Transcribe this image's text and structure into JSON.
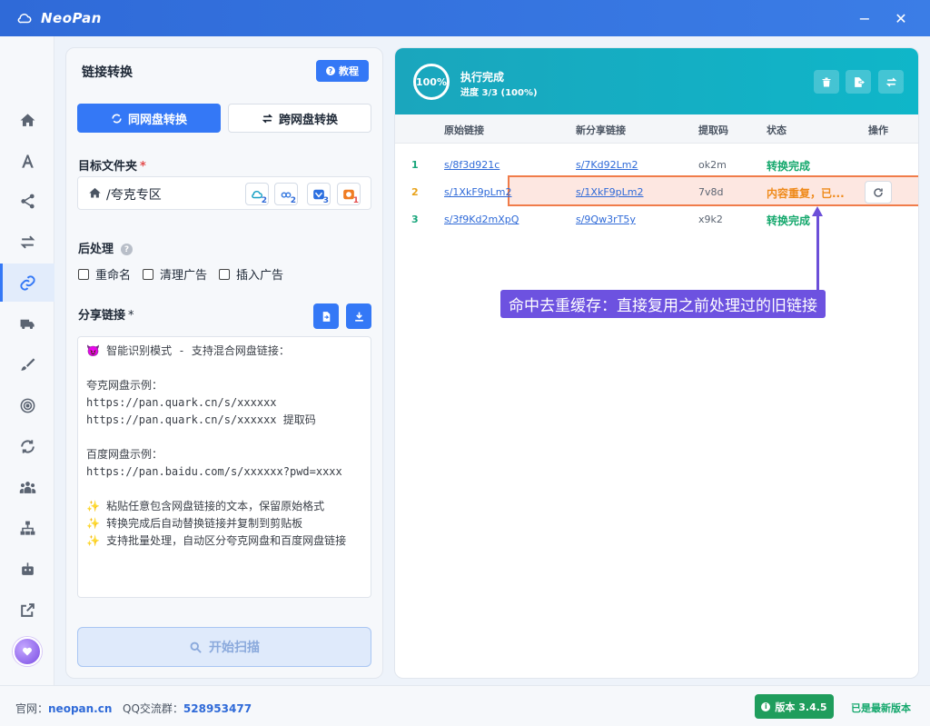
{
  "app": {
    "title": "NeoPan",
    "minimize": "−",
    "close": "✕"
  },
  "sidebar": {
    "items": [
      {
        "name": "home-icon"
      },
      {
        "name": "font-a-icon"
      },
      {
        "name": "share-icon"
      },
      {
        "name": "transfer-icon"
      },
      {
        "name": "link-icon",
        "active": true
      },
      {
        "name": "truck-icon"
      },
      {
        "name": "brush-icon"
      },
      {
        "name": "target-icon"
      },
      {
        "name": "sync-icon"
      },
      {
        "name": "users-icon"
      },
      {
        "name": "sitemap-icon"
      },
      {
        "name": "robot-icon"
      },
      {
        "name": "external-link-icon"
      }
    ]
  },
  "left": {
    "title": "链接转换",
    "tutorial": "教程",
    "mode_same": "同网盘转换",
    "mode_cross": "跨网盘转换",
    "target_folder_label": "目标文件夹",
    "required_mark": "*",
    "folder_name": "/夸克专区",
    "drive_subs": [
      "2",
      "2",
      "3",
      "1"
    ],
    "post_label": "后处理",
    "post_help": "?",
    "options": [
      "重命名",
      "清理广告",
      "插入广告"
    ],
    "share_label": "分享链接",
    "share_required": "*",
    "placeholder": "😈 智能识别模式 - 支持混合网盘链接：\n\n夸克网盘示例：\nhttps://pan.quark.cn/s/xxxxxx\nhttps://pan.quark.cn/s/xxxxxx 提取码\n\n百度网盘示例：\nhttps://pan.baidu.com/s/xxxxxx?pwd=xxxx\n\n✨ 粘贴任意包含网盘链接的文本，保留原始格式\n✨ 转换完成后自动替换链接并复制到剪贴板\n✨ 支持批量处理，自动区分夸克网盘和百度网盘链接",
    "scan": "开始扫描"
  },
  "right": {
    "progress": "100%",
    "progress_value": 100,
    "status": "执行完成",
    "status_sub": "进度 3/3 (100%)",
    "columns": [
      "原始链接",
      "新分享链接",
      "提取码",
      "状态",
      "操作"
    ],
    "rows": [
      {
        "idx": "1",
        "orig": "s/8f3d921c",
        "new": "s/7Kd92Lm2",
        "code": "ok2m",
        "status": "转换完成",
        "state": "ok"
      },
      {
        "idx": "2",
        "orig": "s/1XkF9pLm2",
        "new": "s/1XkF9pLm2",
        "code": "7v8d",
        "status": "内容重复，已...",
        "state": "dup"
      },
      {
        "idx": "3",
        "orig": "s/3f9Kd2mXpQ",
        "new": "s/9Qw3rT5y",
        "code": "x9k2",
        "status": "转换完成",
        "state": "ok"
      }
    ]
  },
  "annotation": "命中去重缓存：直接复用之前处理过的旧链接",
  "footer": {
    "site_label": "官网：",
    "site": "neopan.cn",
    "qq_label": "QQ交流群：",
    "qq": "528953477",
    "version": "版本 3.4.5",
    "latest": "已是最新版本"
  },
  "colors": {
    "accent": "#3478f6",
    "header": "#1aa6bd",
    "success": "#15a86d",
    "warning": "#ef8a1a",
    "annotation": "#6d52e0"
  }
}
